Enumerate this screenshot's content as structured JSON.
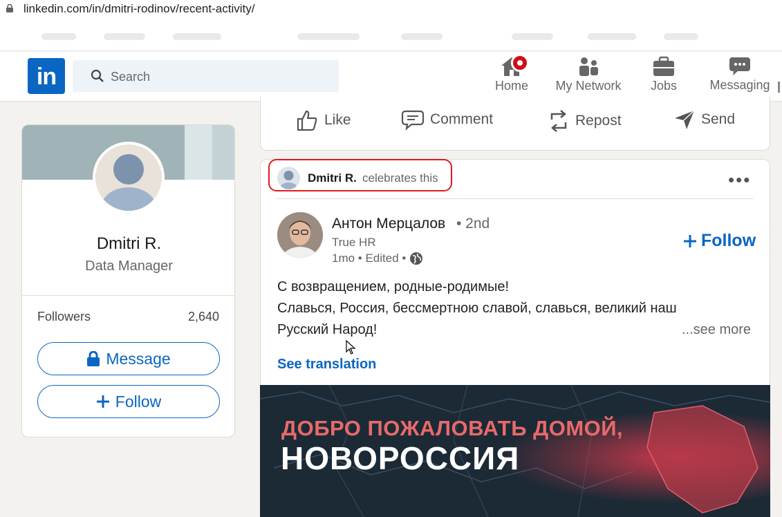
{
  "browser": {
    "url": "linkedin.com/in/dmitri-rodinov/recent-activity/"
  },
  "nav": {
    "search_placeholder": "Search",
    "items": [
      {
        "label": "Home",
        "icon": "home-icon"
      },
      {
        "label": "My Network",
        "icon": "network-icon"
      },
      {
        "label": "Jobs",
        "icon": "briefcase-icon"
      },
      {
        "label": "Messaging",
        "icon": "chat-icon"
      }
    ],
    "brand_color": "#0a66c2"
  },
  "profile": {
    "name": "Dmitri R.",
    "title": "Data Manager",
    "followers_label": "Followers",
    "followers_count": "2,640",
    "message_label": "Message",
    "follow_label": "Follow"
  },
  "actions": {
    "like": "Like",
    "comment": "Comment",
    "repost": "Repost",
    "send": "Send"
  },
  "post": {
    "celebrator_name": "Dmitri R.",
    "celebrate_text": "celebrates this",
    "author_name": "Антон Мерцалов",
    "author_degree": "• 2nd",
    "author_title": "True HR",
    "author_time": "1mo • Edited •",
    "follow_label": "Follow",
    "text_lines": [
      "С возвращением, родные-родимые!",
      "Славься, Россия, бессмертною славой, славься, великий наш",
      "Русский Народ!"
    ],
    "see_more": "...see more",
    "see_translation": "See translation",
    "image_line1": "ДОБРО ПОЖАЛОВАТЬ ДОМОЙ,",
    "image_line2": "НОВОРОССИЯ"
  },
  "colors": {
    "highlight_red": "#e01919",
    "notification_red": "#cc1016"
  }
}
